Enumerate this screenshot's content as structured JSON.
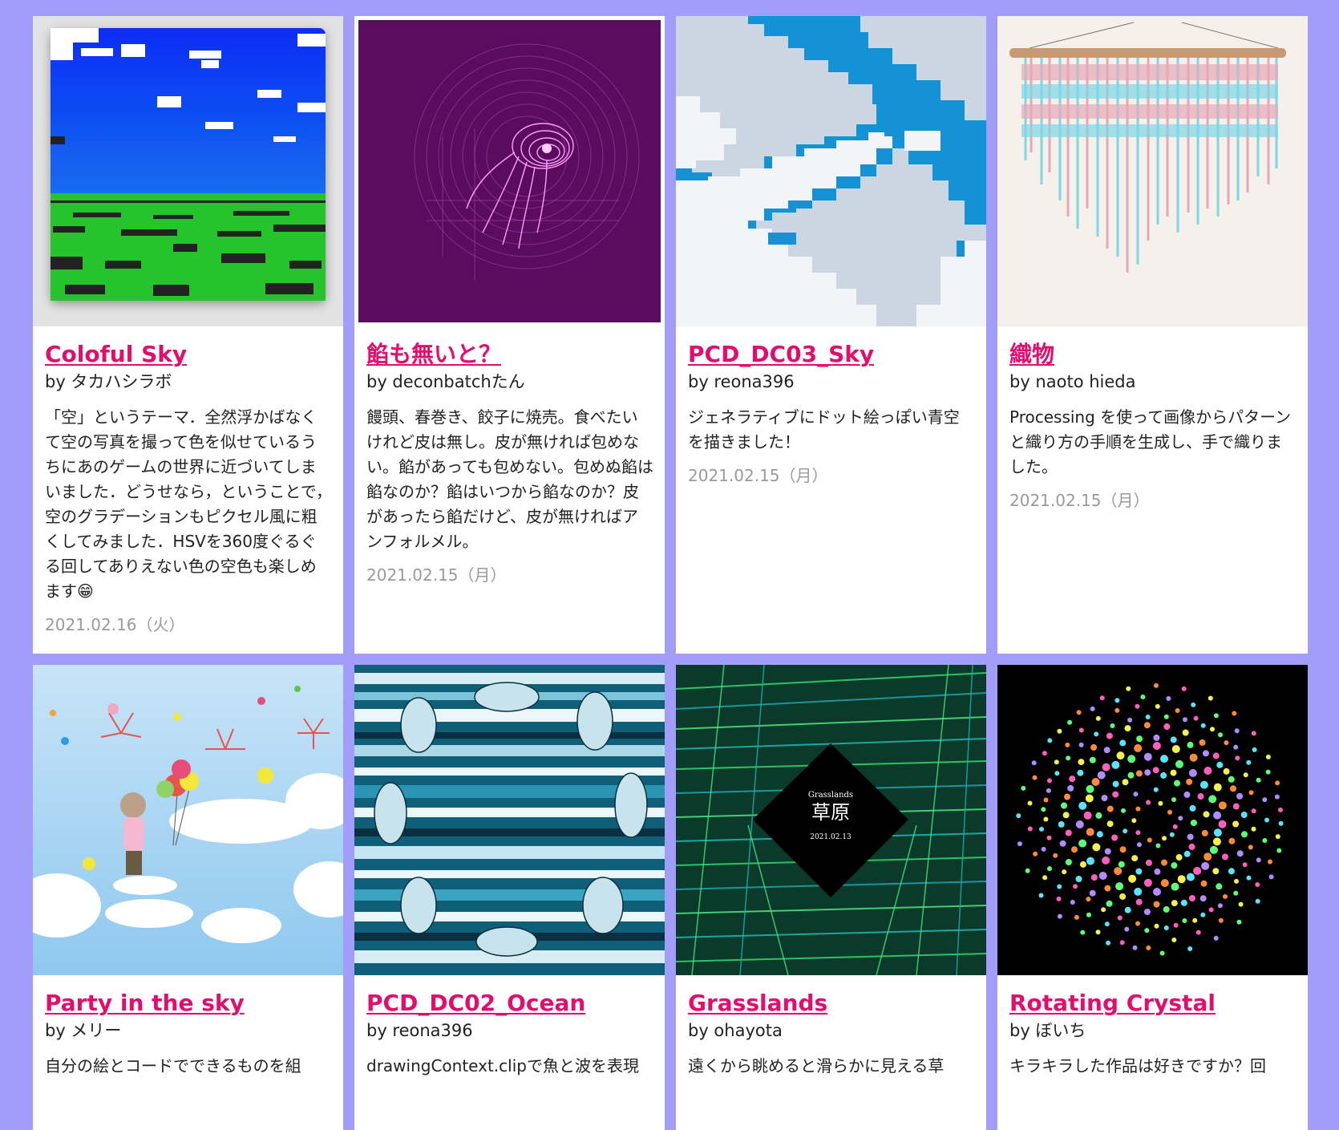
{
  "works": [
    {
      "title": "Coloful Sky",
      "author": "by タカハシラボ",
      "description": "「空」というテーマ．全然浮かばなくて空の写真を撮って色を似せているうちにあのゲームの世界に近づいてしまいました．どうせなら，ということで，空のグラデーションもピクセル風に粗くしてみました．HSVを360度ぐるぐる回してありえない色の空色も楽しめます😁",
      "date": "2021.02.16（火）",
      "thumbnail": "blocky-sky-icon"
    },
    {
      "title": "餡も無いと？",
      "author": "by deconbatchたん",
      "description": "饅頭、春巻き、餃子に焼売。食べたいけれど皮は無し。皮が無ければ包めない。餡があっても包めない。包めぬ餡は餡なのか？餡はいつから餡なのか？皮があったら餡だけど、皮が無ければアンフォルメル。",
      "date": "2021.02.15（月）",
      "thumbnail": "jellyfish-spiral-icon"
    },
    {
      "title": "PCD_DC03_Sky",
      "author": "by reona396",
      "description": "ジェネラティブにドット絵っぽい青空を描きました！",
      "date": "2021.02.15（月）",
      "thumbnail": "pixel-clouds-icon"
    },
    {
      "title": "織物",
      "author": "by naoto hieda",
      "description": "Processing を使って画像からパターンと織り方の手順を生成し、手で織りました。",
      "date": "2021.02.15（月）",
      "thumbnail": "woven-tapestry-icon"
    },
    {
      "title": "Party in the sky",
      "author": "by メリー",
      "description": "自分の絵とコードでできるものを組",
      "date": "",
      "thumbnail": "balloon-girl-icon"
    },
    {
      "title": "PCD_DC02_Ocean",
      "author": "by reona396",
      "description": "drawingContext.clipで魚と波を表現",
      "date": "",
      "thumbnail": "ocean-fish-icon"
    },
    {
      "title": "Grasslands",
      "author": "by ohayota",
      "description": "遠くから眺めると滑らかに見える草",
      "date": "",
      "thumbnail": "grasslands-icon",
      "thumb_text": {
        "en": "Grasslands",
        "jp": "草原",
        "date": "2021.02.13"
      }
    },
    {
      "title": "Rotating Crystal",
      "author": "by ぼいち",
      "description": "キラキラした作品は好きですか？回",
      "date": "",
      "thumbnail": "rotating-crystal-icon"
    }
  ],
  "colors": {
    "page_background": "#a39dfa",
    "title_link": "#e30d6e",
    "date_text": "#9a9a9a"
  }
}
